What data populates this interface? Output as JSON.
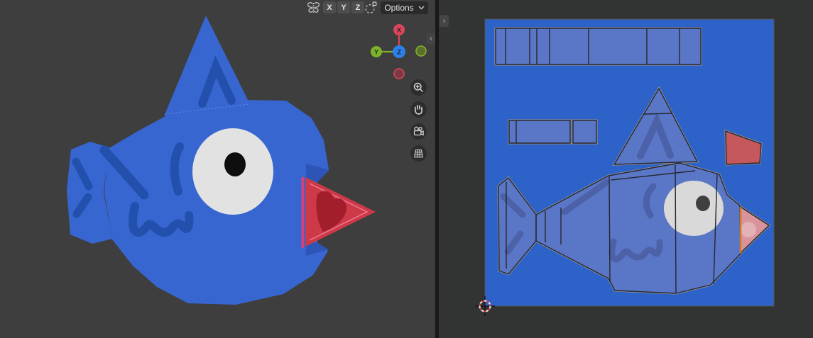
{
  "viewport3d": {
    "header": {
      "symmetry_icon": "butterfly-symmetry",
      "mirror_axis_buttons": [
        "X",
        "Y",
        "Z"
      ],
      "falloff_icon": "proportional-edit-falloff",
      "options": {
        "label": "Options",
        "chevron_icon": "chevron-down"
      }
    },
    "gizmo": {
      "axis_x_label": "X",
      "axis_y_label": "Y",
      "axis_z_label": "Z"
    },
    "nav_buttons": [
      {
        "icon": "zoom-magnifier"
      },
      {
        "icon": "pan-hand"
      },
      {
        "icon": "camera-view"
      },
      {
        "icon": "orthographic-grid"
      }
    ],
    "sidebar_toggle_chevron": "‹",
    "content": "3d-fish-model"
  },
  "uv_editor": {
    "toolbar_toggle_chevron": "›",
    "content": "fish-texture-uv-layout",
    "islands": [
      "top-strip",
      "side-strips",
      "dorsal-fin",
      "lips",
      "mouth-cone",
      "tail-fin",
      "body"
    ],
    "cursor_2d_position": "bottom-left-of-image"
  },
  "colors": {
    "viewport_bg": "#3e3e3e",
    "editor_bg": "#323333",
    "separator": "#191919",
    "chrome_btn": "#4d4d4d",
    "chrome_btn_text": "#e2e2e2",
    "options_bg": "#2a2a2a",
    "icon_gray": "#d2d2d2",
    "tab_bg": "#454547",
    "fish_body": "#3866d1",
    "fish_paint": "#2250ac",
    "eye_white": "#e2e2e2",
    "pupil": "#0e0e0e",
    "lips_red": "#cd3946",
    "lips_heart": "#a31e2b",
    "lips_seam": "#d83e7d",
    "lips_inner": "#ef7a9a",
    "lip_shadow": "#2c55b5",
    "uv_bg": "#2d62c8",
    "uv_island": "#5a77c7",
    "uv_wire": "#26262c",
    "uv_outline": "#8f8f95",
    "uv_paint": "#4c61a8",
    "uv_eye": "#d9d9d9",
    "uv_pupil": "#3f3f3f",
    "uv_lips": "#c4585c",
    "uv_mouth": "#d8939b",
    "uv_mouth_blob": "#e3b2b6",
    "seam_orange": "#d4781e",
    "gizmo_x": "#dc465a",
    "gizmo_y": "#7db428",
    "gizmo_z": "#2c80e8",
    "gizmo_neg_x_fill": "#7a3a44",
    "gizmo_neg_y_fill": "#5f6e2d",
    "nav_btn_bg": "#2d2d2d",
    "cursor_red": "#cc3a44"
  }
}
